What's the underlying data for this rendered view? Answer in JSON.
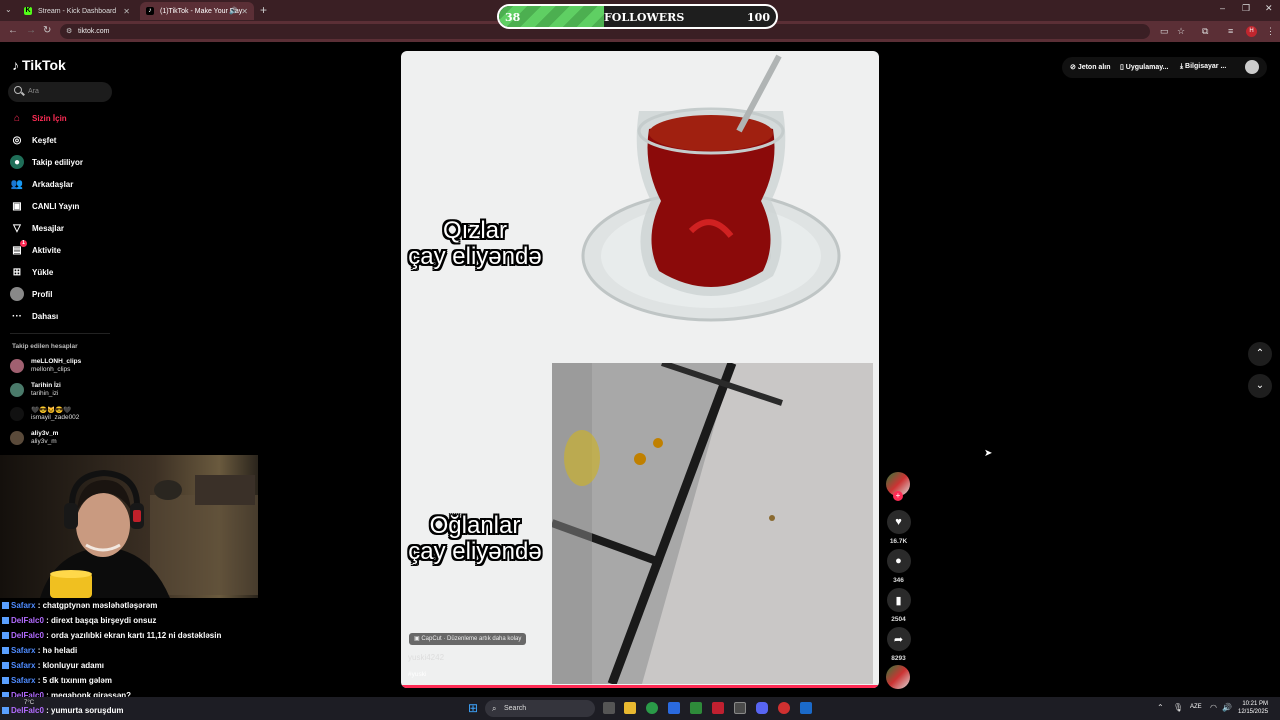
{
  "browser": {
    "tabs": [
      {
        "label": "Stream - Kick Dashboard",
        "icon": "kick-icon"
      },
      {
        "label": "(1)TikTok - Make Your Day",
        "icon": "tiktok-icon"
      }
    ],
    "url": "tiktok.com"
  },
  "followers_overlay": {
    "current": "38",
    "label": "FOLLOWERS",
    "goal": "100",
    "progress_fraction": 0.38
  },
  "tiktok": {
    "logo": "TikTok",
    "search_placeholder": "Ara",
    "nav": [
      {
        "label": "Sizin İçin",
        "icon": "home-icon",
        "active": true
      },
      {
        "label": "Keşfet",
        "icon": "compass-icon"
      },
      {
        "label": "Takip ediliyor",
        "icon": "following-icon"
      },
      {
        "label": "Arkadaşlar",
        "icon": "friends-icon"
      },
      {
        "label": "CANLI Yayın",
        "icon": "live-icon"
      },
      {
        "label": "Mesajlar",
        "icon": "messages-icon"
      },
      {
        "label": "Aktivite",
        "icon": "activity-icon",
        "badge": "1"
      },
      {
        "label": "Yükle",
        "icon": "upload-icon"
      },
      {
        "label": "Profil",
        "icon": "profile-icon"
      },
      {
        "label": "Dahası",
        "icon": "more-icon"
      }
    ],
    "following_title": "Takip edilen hesaplar",
    "following": [
      {
        "name": "meLLONH_clips",
        "handle": "mellonh_clips"
      },
      {
        "name": "Tarihin İzi",
        "handle": "tarihin_izi"
      },
      {
        "name": "🖤😎🐱😎🖤",
        "handle": "ismayil_zade002"
      },
      {
        "name": "aliy3v_m",
        "handle": "aliy3v_m"
      }
    ],
    "top_buttons": {
      "coins": "Jeton alın",
      "app": "Uygulamay...",
      "pc": "Bilgisayar ..."
    }
  },
  "video": {
    "caption_top_line1": "Qızlar",
    "caption_top_line2": "çay eliyəndə",
    "caption_bottom_line1": "Oğlanlar",
    "caption_bottom_line2": "çay eliyəndə",
    "capcut_label": "CapCut · Düzenleme artık daha kolay",
    "username": "yuski4242",
    "hashtag": "#yuski",
    "likes": "16.7K",
    "comments": "346",
    "saves": "2504",
    "shares": "8293"
  },
  "chat": [
    {
      "user": "Safarx",
      "msg": ": chatgptynən məsləhətləşərəm",
      "color": "blue"
    },
    {
      "user": "DelFalc0",
      "msg": ": dirext başqa birşeydi onsuz",
      "color": "purple"
    },
    {
      "user": "DelFalc0",
      "msg": ": orda yazılıbki ekran kartı 11,12 ni dəstəkləsin",
      "color": "purple"
    },
    {
      "user": "Safarx",
      "msg": ": hə heladi",
      "color": "blue"
    },
    {
      "user": "Safarx",
      "msg": ": klonluyur adamı",
      "color": "blue"
    },
    {
      "user": "Safarx",
      "msg": ": 5 dk tıxınım gələm",
      "color": "blue"
    },
    {
      "user": "DelFalc0",
      "msg": ": megabonk girəssən?",
      "color": "purple"
    },
    {
      "user": "DelFalc0",
      "msg": ": yumurta soruşdum",
      "color": "purple"
    }
  ],
  "taskbar": {
    "search": "Search",
    "weather": "7°C",
    "lang": "AZE",
    "time": "10:21 PM",
    "date": "12/15/2025"
  },
  "colors": {
    "tiktok_red": "#fe2c55",
    "progress_green": "#4caf50",
    "chrome_tab": "#3a1f24"
  }
}
